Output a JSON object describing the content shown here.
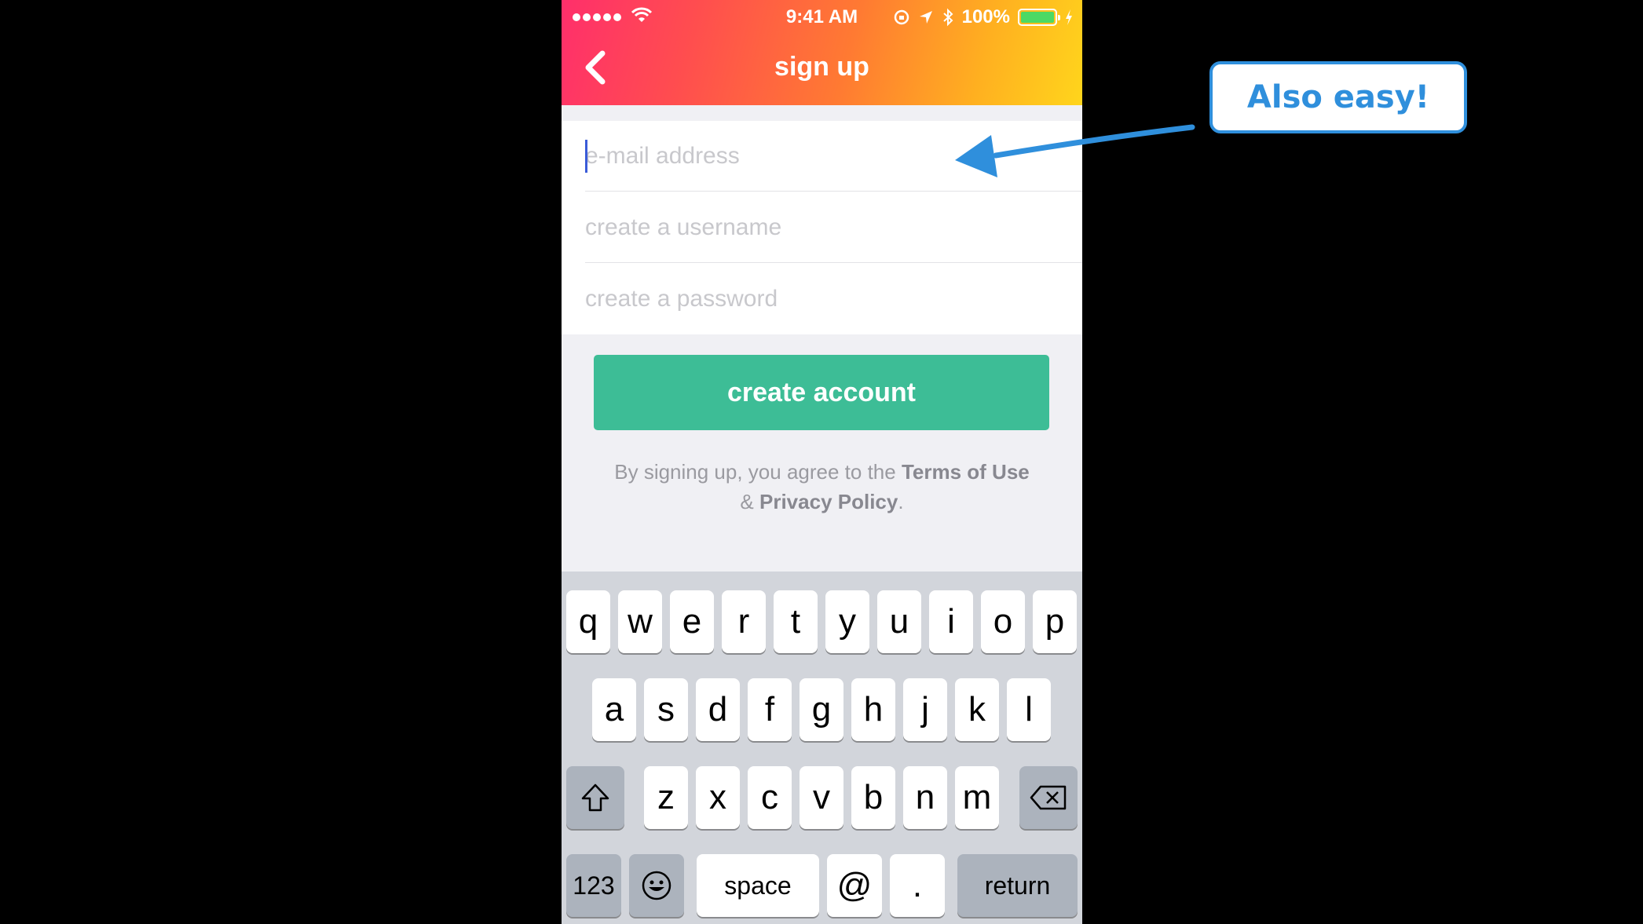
{
  "status_bar": {
    "time": "9:41 AM",
    "battery": "100%",
    "icons": [
      "signal-dots-icon",
      "wifi-icon",
      "rotation-lock-icon",
      "location-arrow-icon",
      "bluetooth-icon",
      "battery-icon",
      "charging-bolt-icon"
    ]
  },
  "nav": {
    "title": "sign up",
    "back_icon": "chevron-left-icon"
  },
  "form": {
    "email_placeholder": "e-mail address",
    "username_placeholder": "create a username",
    "password_placeholder": "create a password",
    "submit_label": "create account"
  },
  "terms": {
    "prefix": "By signing up, you agree to the ",
    "terms_link": "Terms of Use",
    "joiner": " & ",
    "privacy_link": "Privacy Policy",
    "suffix": "."
  },
  "keyboard": {
    "row1": [
      "q",
      "w",
      "e",
      "r",
      "t",
      "y",
      "u",
      "i",
      "o",
      "p"
    ],
    "row2": [
      "a",
      "s",
      "d",
      "f",
      "g",
      "h",
      "j",
      "k",
      "l"
    ],
    "row3": [
      "z",
      "x",
      "c",
      "v",
      "b",
      "n",
      "m"
    ],
    "numbers_label": "123",
    "space_label": "space",
    "at_label": "@",
    "dot_label": ".",
    "return_label": "return"
  },
  "annotation": {
    "callout_text": "Also easy!"
  },
  "colors": {
    "accent_green": "#3dbd96",
    "callout_blue": "#2f8fdc",
    "header_gradient_start": "#ff2f6b",
    "header_gradient_end": "#ffd51c"
  }
}
